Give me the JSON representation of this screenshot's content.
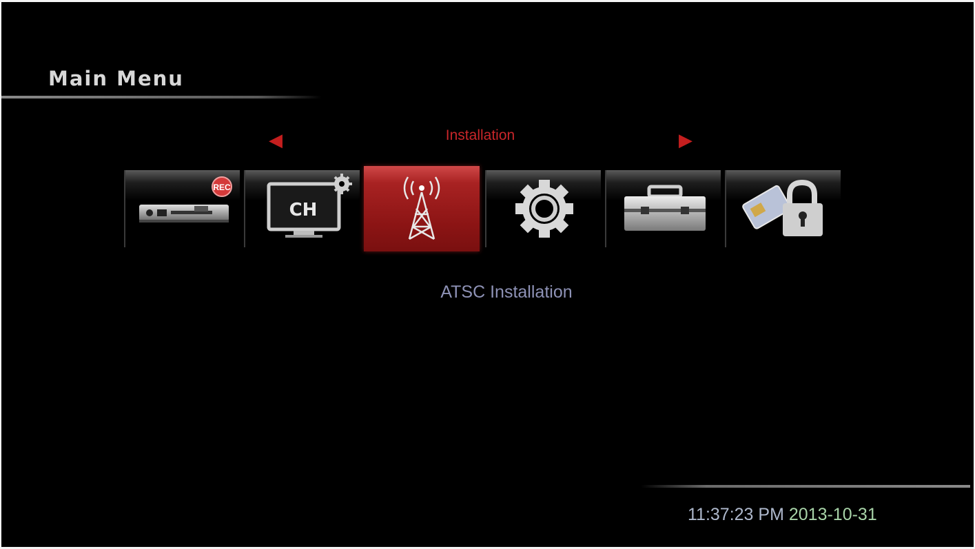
{
  "header": {
    "title": "Main Menu"
  },
  "menu": {
    "current_category": "Installation",
    "prev_arrow": "◀",
    "next_arrow": "▶",
    "tiles": [
      {
        "icon": "settop-box-icon",
        "selected": false
      },
      {
        "icon": "channel-tv-icon",
        "label": "CH",
        "selected": false
      },
      {
        "icon": "antenna-tower-icon",
        "selected": true
      },
      {
        "icon": "gear-icon",
        "selected": false
      },
      {
        "icon": "toolbox-icon",
        "selected": false
      },
      {
        "icon": "card-lock-icon",
        "selected": false
      }
    ],
    "selected_item": "ATSC Installation"
  },
  "status": {
    "time": "11:37:23 PM",
    "date": "2013-10-31"
  },
  "colors": {
    "accent": "#c8262a",
    "subtitle": "#8e92b6",
    "background": "#000000"
  }
}
